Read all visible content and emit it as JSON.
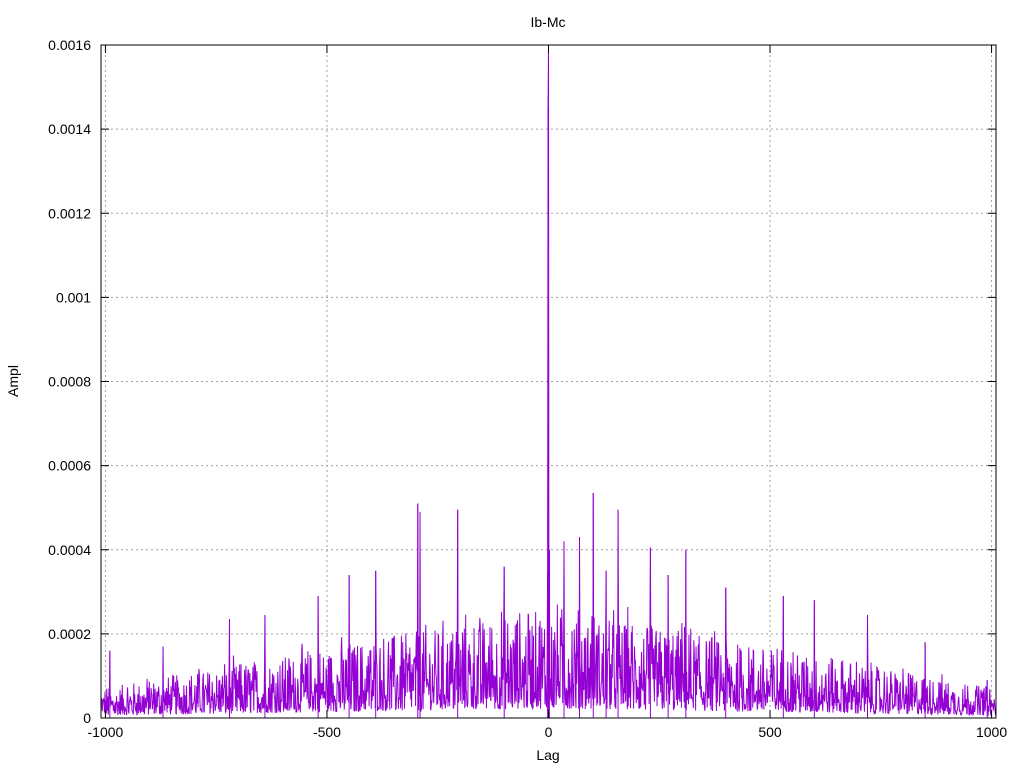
{
  "chart_data": {
    "type": "line",
    "title": "Ib-Mc",
    "xlabel": "Lag",
    "ylabel": "Ampl",
    "xlim": [
      -1010,
      1010
    ],
    "ylim": [
      0,
      0.0016
    ],
    "x_ticks": [
      -1000,
      -500,
      0,
      500,
      1000
    ],
    "x_tick_labels": [
      "-1000",
      "-500",
      "0",
      "500",
      "1000"
    ],
    "y_ticks": [
      0,
      0.0002,
      0.0004,
      0.0006,
      0.0008,
      0.001,
      0.0012,
      0.0014,
      0.0016
    ],
    "y_tick_labels": [
      "0",
      "0.0002",
      "0.0004",
      "0.0006",
      "0.0008",
      "0.001",
      "0.0012",
      "0.0014",
      "0.0016"
    ],
    "grid": true,
    "legend": "none",
    "series_color": "#9400d3",
    "x_step": 1,
    "series": [
      {
        "x_start": -1010,
        "peaks": [
          {
            "x": 0,
            "y": 0.0016
          },
          {
            "x": -1,
            "y": 0.00145
          },
          {
            "x": 2,
            "y": 0.0004
          },
          {
            "x": -2,
            "y": 0.00035
          },
          {
            "x": 101,
            "y": 0.000535
          },
          {
            "x": -295,
            "y": 0.00051
          },
          {
            "x": 157,
            "y": 0.000495
          },
          {
            "x": -205,
            "y": 0.000495
          },
          {
            "x": -290,
            "y": 0.00049
          },
          {
            "x": 35,
            "y": 0.00042
          },
          {
            "x": 310,
            "y": 0.0004
          },
          {
            "x": 230,
            "y": 0.000405
          },
          {
            "x": 70,
            "y": 0.00043
          },
          {
            "x": -100,
            "y": 0.00036
          },
          {
            "x": -390,
            "y": 0.00035
          },
          {
            "x": -450,
            "y": 0.00034
          },
          {
            "x": 130,
            "y": 0.00035
          },
          {
            "x": 270,
            "y": 0.00034
          },
          {
            "x": 400,
            "y": 0.00031
          },
          {
            "x": -520,
            "y": 0.00029
          },
          {
            "x": -640,
            "y": 0.000245
          },
          {
            "x": -720,
            "y": 0.000235
          },
          {
            "x": 720,
            "y": 0.000245
          },
          {
            "x": 600,
            "y": 0.00028
          },
          {
            "x": 530,
            "y": 0.00029
          },
          {
            "x": -990,
            "y": 0.00016
          },
          {
            "x": -870,
            "y": 0.00017
          },
          {
            "x": 850,
            "y": 0.00018
          },
          {
            "x": 990,
            "y": 9e-05
          }
        ]
      }
    ]
  }
}
